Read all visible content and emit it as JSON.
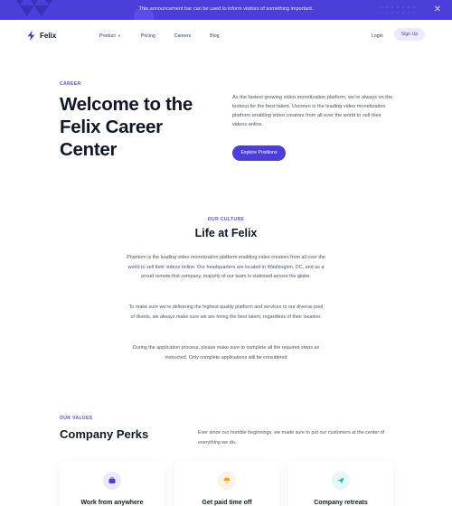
{
  "announcement": {
    "message": "This announcement bar can be used to inform visitors of something important.",
    "close_icon": "close-icon"
  },
  "nav": {
    "logo_text": "Felix",
    "links": [
      "Product",
      "Pricing",
      "Careers",
      "Blog"
    ],
    "login_label": "Login",
    "signup_label": "Sign Up"
  },
  "hero": {
    "eyebrow": "CAREER",
    "title": "Welcome to the Felix Career Center",
    "description": "As the fastest growing video monetization platform, we're always on the lookout for the best talent. Uscreen is the leading video monetization platform enabling video creators from all over the world to sell their videos online.",
    "button_label": "Explore Positions"
  },
  "culture": {
    "eyebrow": "OUR CULTURE",
    "title": "Life at Felix",
    "paragraphs": [
      "Phantom is the leading video monetization platform enabling video creators from all over the world to sell their videos online. Our headquarters are located in Washington, DC, and as a proud remote-first company, majority of our team is stationed across the globe.",
      "To make sure we're delivering the highest quality platform and services to our diverse pool of clients, we always make sure we are hiring the best talent, regardless of their location.",
      "During the application process, please make sure to complete all the required steps as instructed. Only complete applications will be considered"
    ]
  },
  "values": {
    "eyebrow": "OUR VALUES",
    "title": "Company Perks",
    "description": "Ever since our humble beginnings, we made sure to put our customers at the center of everything we do.",
    "cards": [
      {
        "title": "Work from anywhere",
        "icon": "briefcase-icon"
      },
      {
        "title": "Get paid time off",
        "icon": "umbrella-icon"
      },
      {
        "title": "Company retreats",
        "icon": "plane-icon"
      }
    ]
  },
  "colors": {
    "accent": "#4c3fd9",
    "announcement_bg": "#4c3fd9",
    "heading": "#0f172a",
    "body_text": "#4b5563"
  }
}
